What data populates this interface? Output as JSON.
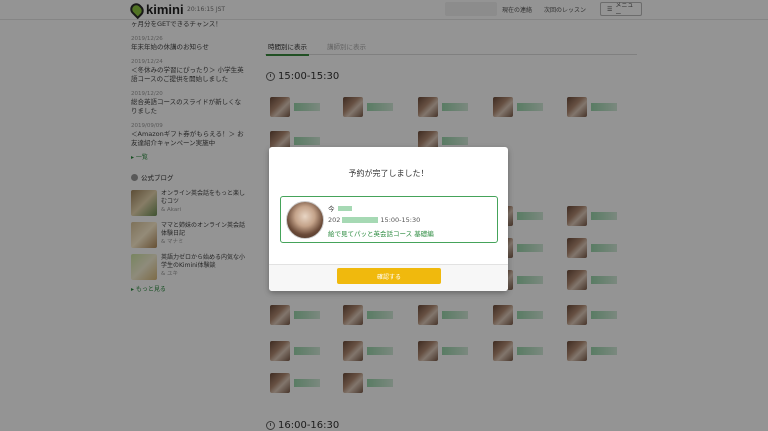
{
  "header": {
    "logo_text": "kimini",
    "clock": "20:16:15 JST",
    "nav": [
      "現在の連絡",
      "次回のレッスン"
    ],
    "menu_label": "メニュー"
  },
  "sidebar": {
    "news": [
      {
        "date": "",
        "title": "ヶ月分をGETできるチャンス！"
      },
      {
        "date": "2019/12/26",
        "title": "年末年始の休講のお知らせ"
      },
      {
        "date": "2019/12/24",
        "title": "＜冬休みの学習にぴったり＞ 小学生英語コースのご提供を開始しました"
      },
      {
        "date": "2019/12/20",
        "title": "総合英語コースのスライドが新しくなりました"
      },
      {
        "date": "2019/09/09",
        "title": "＜Amazonギフト券がもらえる！＞ お友達紹介キャンペーン実施中"
      }
    ],
    "more_news": "▸ 一覧",
    "blog_heading": "公式ブログ",
    "blogs": [
      {
        "title": "オンライン英会話をもっと楽しむコツ",
        "author": "& Akari"
      },
      {
        "title": "ママと姉妹のオンライン英会話 体験日記",
        "author": "& マナミ"
      },
      {
        "title": "英語力ゼロから始める内気な小学生のKimini体験談",
        "author": "& ユキ"
      }
    ],
    "more_blogs": "▸ もっと見る"
  },
  "main": {
    "tabs": [
      "時間別に表示",
      "講師別に表示"
    ],
    "slots": [
      "15:00-15:30",
      "16:00-16:30"
    ]
  },
  "modal": {
    "title": "予約が完了しました！",
    "teacher_prefix": "今",
    "date_prefix": "202",
    "time": "15:00-15:30",
    "course": "絵で見てパッと英会話コース 基礎編",
    "confirm_label": "確認する"
  },
  "colors": {
    "accent_green": "#3a8a3e",
    "confirm_yellow": "#f0b90d",
    "overlay": "rgba(0,0,0,0.42)"
  }
}
